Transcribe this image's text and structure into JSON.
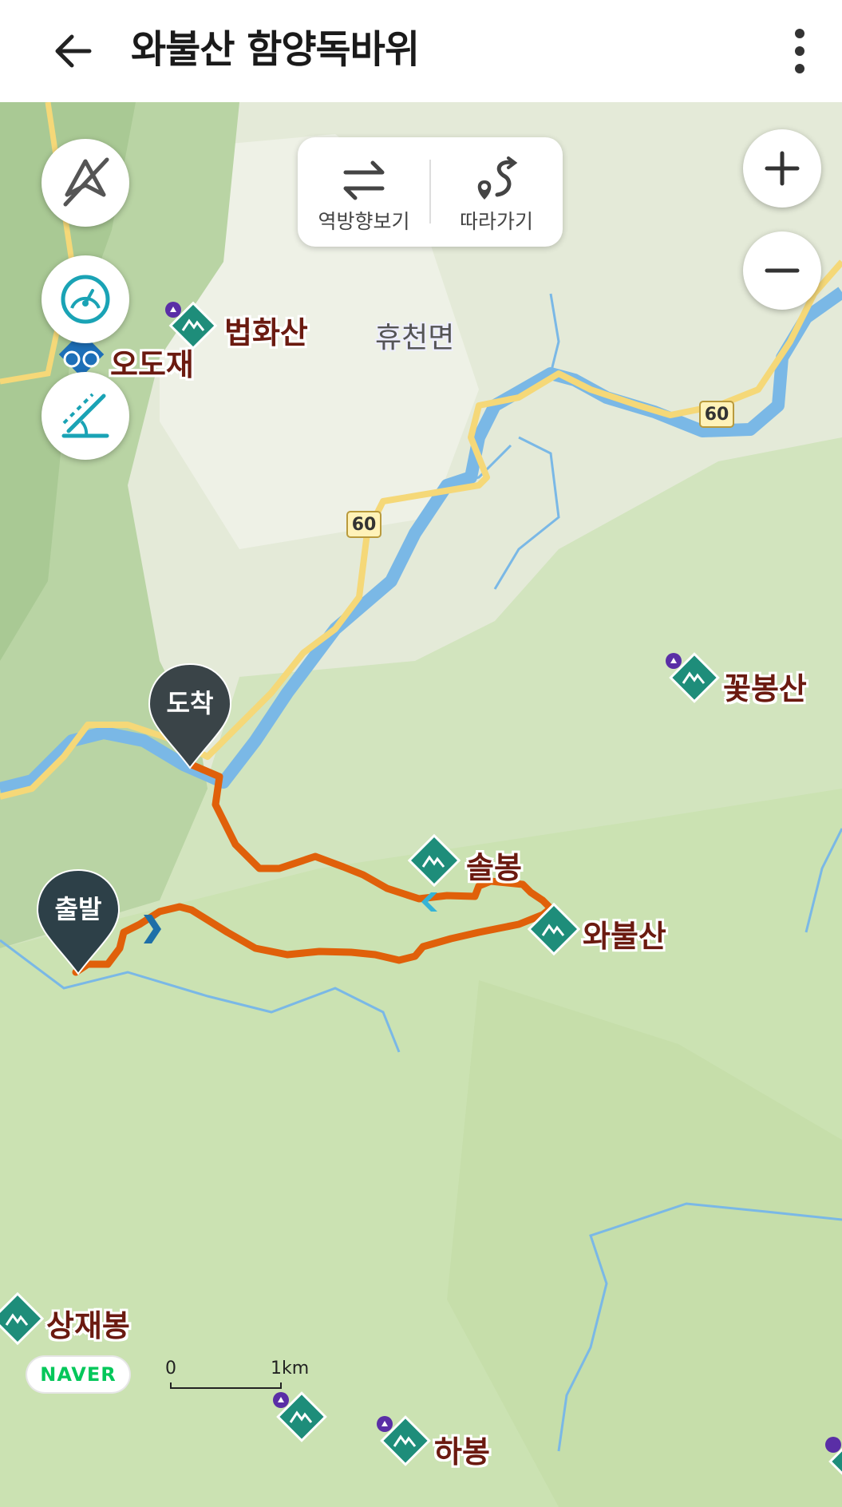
{
  "header": {
    "title": "와불산 함양독바위",
    "back_icon": "arrow-left-icon",
    "more_icon": "more-vertical-icon"
  },
  "toolbar": {
    "reverse_label": "역방향보기",
    "follow_label": "따라가기"
  },
  "map_controls": {
    "compass_off_icon": "compass-off-icon",
    "speed_icon": "speedometer-icon",
    "slope_icon": "slope-icon",
    "zoom_in_icon": "plus-icon",
    "zoom_out_icon": "minus-icon"
  },
  "map": {
    "area_label": "휴천면",
    "road_number": "60",
    "start_label": "출발",
    "end_label": "도착",
    "pois": [
      {
        "name": "법화산"
      },
      {
        "name": "오도재"
      },
      {
        "name": "꽃봉산"
      },
      {
        "name": "솔봉"
      },
      {
        "name": "와불산"
      },
      {
        "name": "상재봉"
      },
      {
        "name": "하봉"
      }
    ]
  },
  "footer": {
    "naver_logo": "NAVER",
    "scale_start": "0",
    "scale_end": "1km"
  },
  "colors": {
    "route": "#e0600a",
    "river": "#7ab8e6",
    "road": "#f5d878",
    "poi": "#1e8d7a",
    "pin": "#3a4448"
  }
}
